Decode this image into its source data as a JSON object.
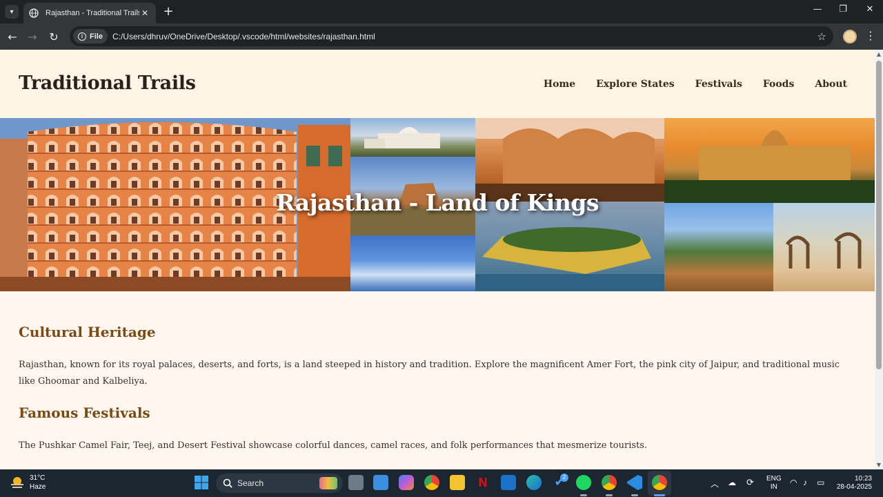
{
  "browser": {
    "tab": {
      "title": "Rajasthan - Traditional Trails",
      "close": "✕"
    },
    "new_tab": "+",
    "window_controls": {
      "minimize": "—",
      "maximize": "❐",
      "close": "✕"
    },
    "address": {
      "chip_label": "File",
      "url": "C:/Users/dhruv/OneDrive/Desktop/.vscode/html/websites/rajasthan.html"
    }
  },
  "site": {
    "brand": "Traditional Trails",
    "nav": [
      "Home",
      "Explore States",
      "Festivals",
      "Foods",
      "About"
    ],
    "hero_title": "Rajasthan - Land of Kings",
    "sections": [
      {
        "heading": "Cultural Heritage",
        "text": "Rajasthan, known for its royal palaces, deserts, and forts, is a land steeped in history and tradition. Explore the magnificent Amer Fort, the pink city of Jaipur, and traditional music like Ghoomar and Kalbeliya."
      },
      {
        "heading": "Famous Festivals",
        "text": "The Pushkar Camel Fair, Teej, and Desert Festival showcase colorful dances, camel races, and folk performances that mesmerize tourists."
      }
    ]
  },
  "taskbar": {
    "weather": {
      "temp": "31°C",
      "condition": "Haze"
    },
    "search_label": "Search",
    "badge": "2",
    "tray": {
      "lang1": "ENG",
      "lang2": "IN",
      "time": "10:23",
      "date": "28-04-2025"
    }
  },
  "colors": {
    "page_bg": "#fff6ef",
    "header_bg": "#fff5e6",
    "heading": "#7a4a12",
    "taskbar": "#1c2631"
  }
}
